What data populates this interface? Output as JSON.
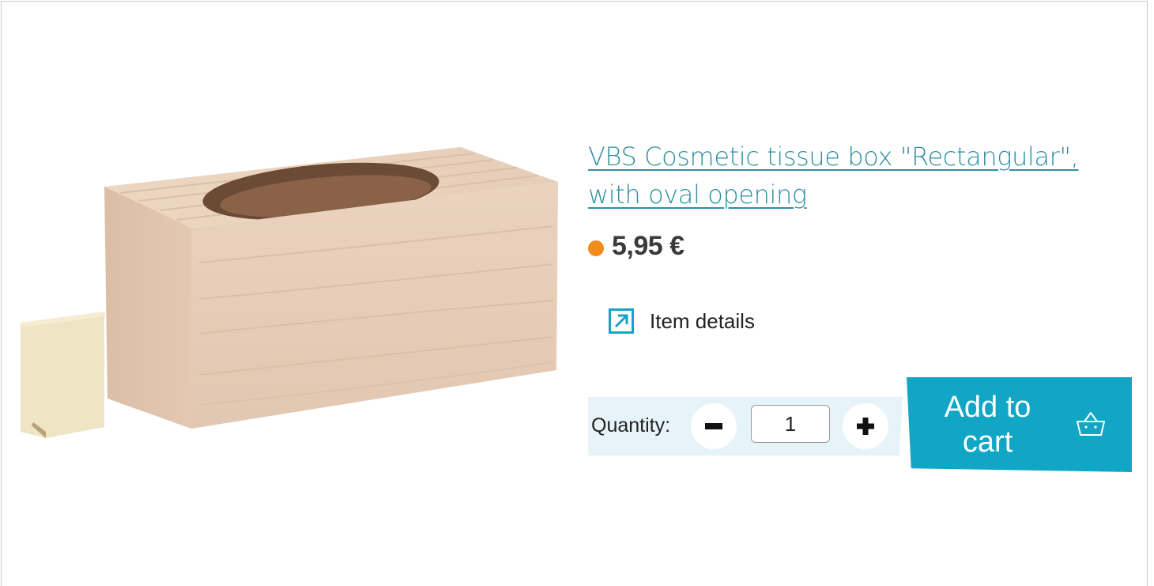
{
  "product": {
    "title": "VBS Cosmetic tissue box \"Rectangular\", with oval opening",
    "price": "5,95 €",
    "price_status_color": "#f28c1c",
    "image_alt": "Wooden tissue box with oval opening and sliding bottom panel"
  },
  "details": {
    "label": "Item details",
    "icon": "external-arrow-icon"
  },
  "quantity": {
    "label": "Quantity:",
    "value": "1",
    "decrease_icon": "minus-icon",
    "increase_icon": "plus-icon"
  },
  "cart": {
    "label": "Add to cart",
    "icon": "basket-icon"
  },
  "colors": {
    "accent": "#12a6c6",
    "link": "#2f8fa3",
    "panel": "#e6f4f9"
  }
}
